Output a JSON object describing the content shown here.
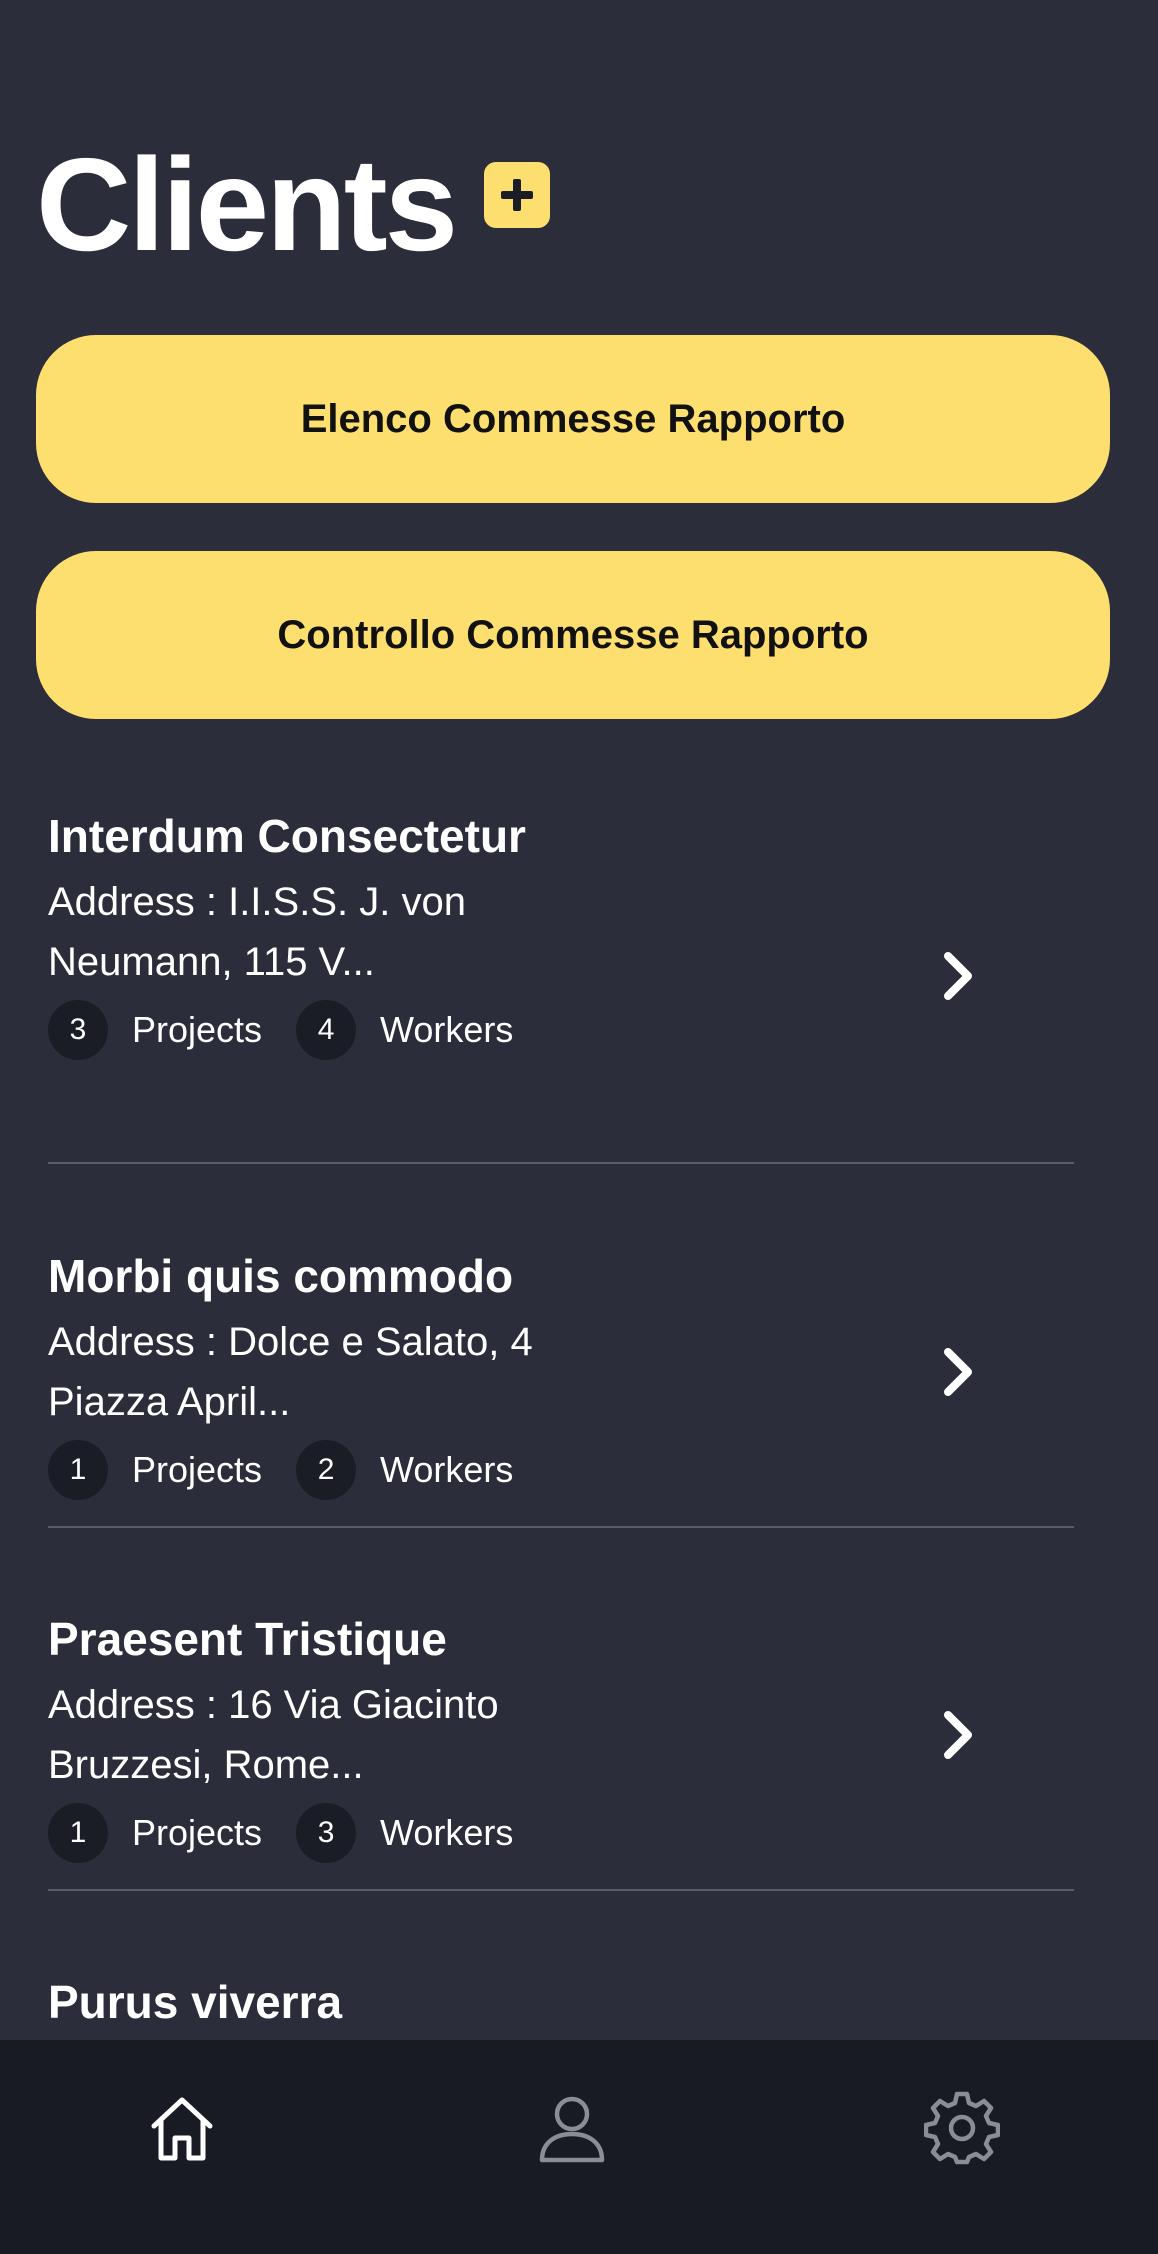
{
  "header": {
    "title": "Clients"
  },
  "actions": [
    {
      "label": "Elenco Commesse Rapporto"
    },
    {
      "label": "Controllo Commesse Rapporto"
    }
  ],
  "clients": [
    {
      "name": "Interdum Consectetur",
      "address": "Address : I.I.S.S. J. von Neumann, 115 V...",
      "projects_count": "3",
      "projects_label": "Projects",
      "workers_count": "4",
      "workers_label": "Workers"
    },
    {
      "name": "Morbi quis commodo",
      "address": "Address : Dolce e Salato, 4 Piazza April...",
      "projects_count": "1",
      "projects_label": "Projects",
      "workers_count": "2",
      "workers_label": "Workers"
    },
    {
      "name": "Praesent Tristique",
      "address": "Address : 16 Via Giacinto Bruzzesi, Rome...",
      "projects_count": "1",
      "projects_label": "Projects",
      "workers_count": "3",
      "workers_label": "Workers"
    },
    {
      "name": "Purus viverra"
    }
  ],
  "bottom_nav": {
    "items": [
      {
        "icon": "home-icon",
        "active": true
      },
      {
        "icon": "user-icon",
        "active": false
      },
      {
        "icon": "gear-icon",
        "active": false
      }
    ]
  },
  "colors": {
    "background": "#2b2d3a",
    "accent": "#fddf70",
    "nav_background": "#181a24",
    "badge_background": "#1a1c26",
    "inactive_icon": "#8a8c96"
  }
}
